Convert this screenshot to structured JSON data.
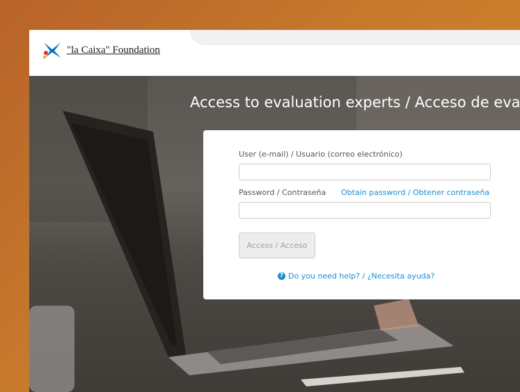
{
  "header": {
    "brand": "\"la Caixa\" Foundation",
    "logo_icon": "star-logo-icon"
  },
  "page": {
    "title": "Access to evaluation experts / Acceso de evaluadores"
  },
  "login": {
    "user_label": "User (e-mail) / Usuario (correo electrónico)",
    "user_value": "",
    "password_label": "Password / Contraseña",
    "obtain_password_link": "Obtain password / Obtener contraseña",
    "password_value": "",
    "submit_label": "Access / Acceso",
    "help_link": "Do you need help? / ¿Necesita ayuda?",
    "help_icon": "question-circle-icon"
  },
  "colors": {
    "link": "#1a8fd0",
    "logo_blue": "#0071bc",
    "logo_red": "#e0312b",
    "logo_yellow": "#f4b400"
  }
}
